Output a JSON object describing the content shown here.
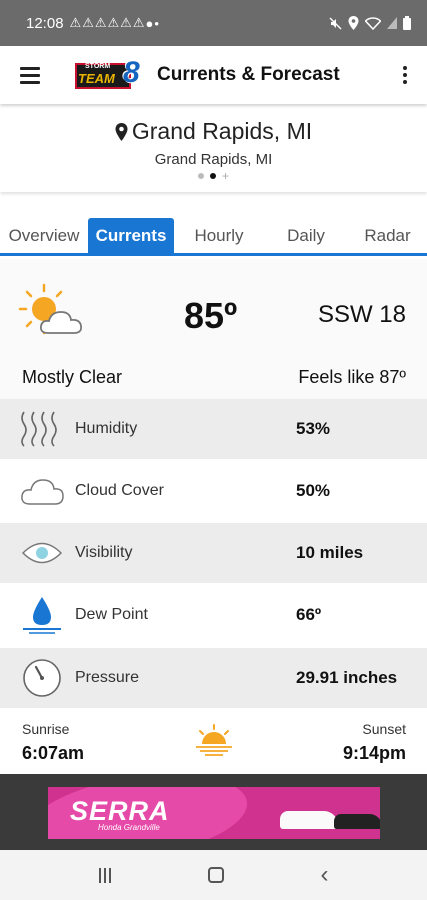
{
  "status": {
    "time": "12:08",
    "warnings": [
      "⚠",
      "⚠",
      "⚠",
      "⚠",
      "⚠",
      "⚠"
    ]
  },
  "appbar": {
    "title": "Currents & Forecast",
    "logo_storm": "STORM",
    "logo_team": "TEAM",
    "logo_number": "8"
  },
  "location": {
    "name": "Grand Rapids, MI",
    "subtitle": "Grand Rapids, MI",
    "page_count": 2,
    "active_page": 1
  },
  "tabs": [
    {
      "label": "Overview",
      "active": false
    },
    {
      "label": "Currents",
      "active": true
    },
    {
      "label": "Hourly",
      "active": false
    },
    {
      "label": "Daily",
      "active": false
    },
    {
      "label": "Radar",
      "active": false
    }
  ],
  "current": {
    "icon": "partly-sunny-icon",
    "temperature": "85º",
    "wind": "SSW  18",
    "condition": "Mostly Clear",
    "feels_like": "Feels like 87º"
  },
  "details": [
    {
      "icon": "humidity-icon",
      "label": "Humidity",
      "value": "53%"
    },
    {
      "icon": "cloud-icon",
      "label": "Cloud Cover",
      "value": "50%"
    },
    {
      "icon": "eye-icon",
      "label": "Visibility",
      "value": "10 miles"
    },
    {
      "icon": "droplet-icon",
      "label": "Dew Point",
      "value": "66º"
    },
    {
      "icon": "gauge-icon",
      "label": "Pressure",
      "value": "29.91 inches"
    }
  ],
  "sun": {
    "sunrise_label": "Sunrise",
    "sunrise_time": "6:07am",
    "sunset_label": "Sunset",
    "sunset_time": "9:14pm"
  },
  "ad": {
    "brand": "SERRA",
    "tagline": "Honda Grandville"
  },
  "colors": {
    "accent": "#1976d2",
    "sun": "#f5a623",
    "status_bar": "#6b6b6b",
    "ad_background": "#d0328f"
  }
}
